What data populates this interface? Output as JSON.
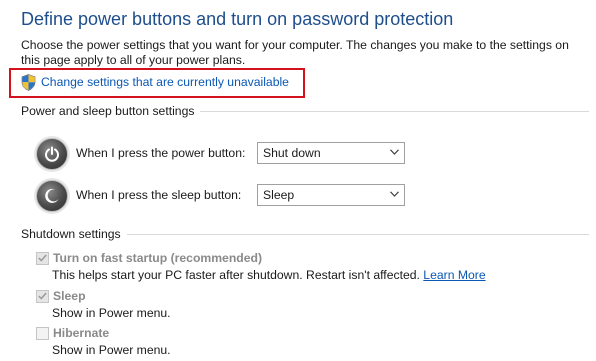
{
  "page": {
    "title": "Define power buttons and turn on password protection",
    "intro": "Choose the power settings that you want for your computer. The changes you make to the settings on this page apply to all of your power plans.",
    "change_link": "Change settings that are currently unavailable"
  },
  "power_sleep": {
    "heading": "Power and sleep button settings",
    "power_button": {
      "label": "When I press the power button:",
      "value": "Shut down",
      "icon": "power-icon"
    },
    "sleep_button": {
      "label": "When I press the sleep button:",
      "value": "Sleep",
      "icon": "sleep-icon"
    }
  },
  "shutdown": {
    "heading": "Shutdown settings",
    "fast_startup": {
      "label": "Turn on fast startup (recommended)",
      "checked": true,
      "description": "This helps start your PC faster after shutdown. Restart isn't affected.",
      "link": "Learn More"
    },
    "sleep": {
      "label": "Sleep",
      "checked": true,
      "description": "Show in Power menu."
    },
    "hibernate": {
      "label": "Hibernate",
      "checked": false,
      "description": "Show in Power menu."
    }
  },
  "colors": {
    "title": "#1e4e8c",
    "link": "#0a58b4",
    "highlight_border": "#d3121c",
    "disabled_text": "#8a8a8a"
  }
}
